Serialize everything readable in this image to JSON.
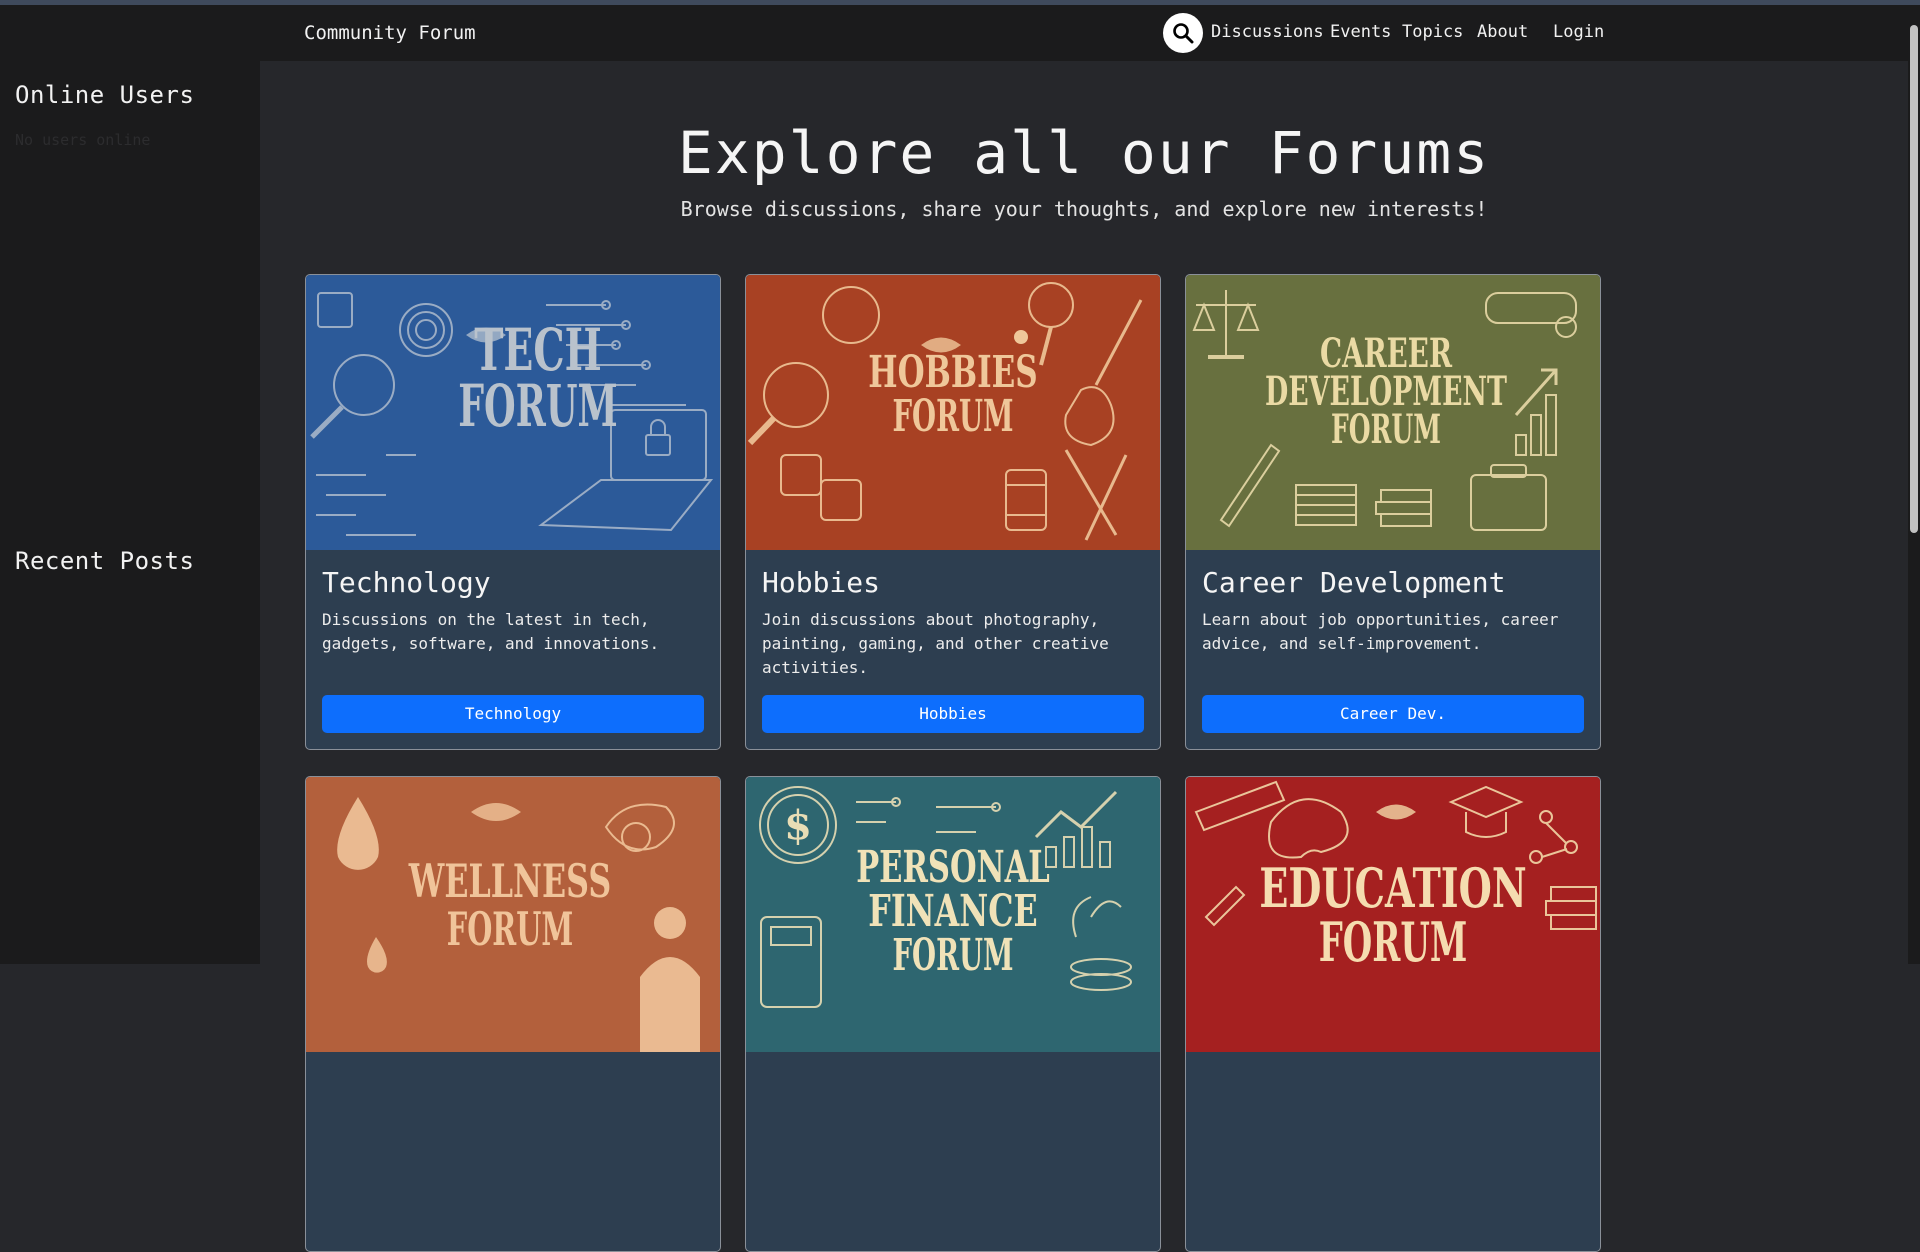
{
  "navbar": {
    "brand": "Community Forum",
    "search_icon": "search-icon",
    "links": [
      "Discussions",
      "Events",
      "Topics",
      "About",
      "Login"
    ]
  },
  "sidebar": {
    "online_title": "Online Users",
    "online_empty": "No users online",
    "recent_title": "Recent Posts"
  },
  "hero": {
    "title": "Explore all our Forums",
    "subtitle": "Browse discussions, share your thoughts, and explore new interests!"
  },
  "cards": [
    {
      "title": "Technology",
      "desc": "Discussions on the latest in tech, gadgets, software, and innovations.",
      "button": "Technology",
      "banner": [
        "TECH",
        "FORUM"
      ],
      "color": "#2c5a99"
    },
    {
      "title": "Hobbies",
      "desc": "Join discussions about photography, painting, gaming, and other creative activities.",
      "button": "Hobbies",
      "banner": [
        "HOBBIES",
        "FORUM"
      ],
      "color": "#a84123"
    },
    {
      "title": "Career Development",
      "desc": "Learn about job opportunities, career advice, and self-improvement.",
      "button": "Career Dev.",
      "banner": [
        "CAREER",
        "DEVELOPMENT",
        "FORUM"
      ],
      "color": "#68703f"
    },
    {
      "banner": [
        "WELLNESS",
        "FORUM"
      ],
      "color": "#b3603c"
    },
    {
      "banner": [
        "PERSONAL",
        "FINANCE",
        "FORUM"
      ],
      "color": "#2e6670"
    },
    {
      "banner": [
        "EDUCATION",
        "FORUM"
      ],
      "color": "#a52020"
    }
  ]
}
